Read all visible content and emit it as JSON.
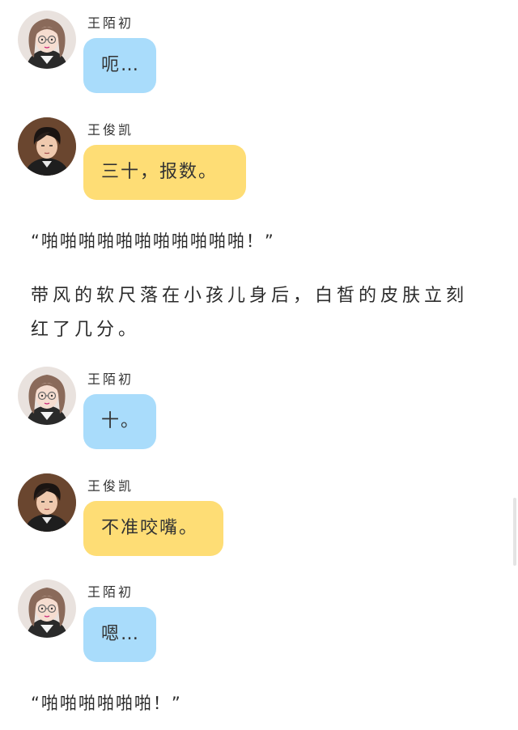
{
  "messages": [
    {
      "name": "王陌初",
      "text": "呃…",
      "bubble_color": "#a9dcfb"
    },
    {
      "name": "王俊凯",
      "text": "三十，报数。",
      "bubble_color": "#fedd75"
    },
    {
      "name": "王陌初",
      "text": "十。",
      "bubble_color": "#a9dcfb"
    },
    {
      "name": "王俊凯",
      "text": "不准咬嘴。",
      "bubble_color": "#fedd75"
    },
    {
      "name": "王陌初",
      "text": "嗯…",
      "bubble_color": "#a9dcfb"
    }
  ],
  "narration": {
    "quote_1": "“啪啪啪啪啪啪啪啪啪啪啪！”",
    "paragraph_line_1": "带风的软尺落在小孩儿身后，白皙的皮肤立刻",
    "paragraph_line_2": "红了几分。",
    "quote_2": "“啪啪啪啪啪啪！”"
  },
  "avatars": {
    "girl": "girl-avatar-icon",
    "boy": "boy-avatar-icon"
  },
  "colors": {
    "blue_bubble": "#a9dcfb",
    "yellow_bubble": "#fedd75",
    "background": "#ffffff"
  }
}
